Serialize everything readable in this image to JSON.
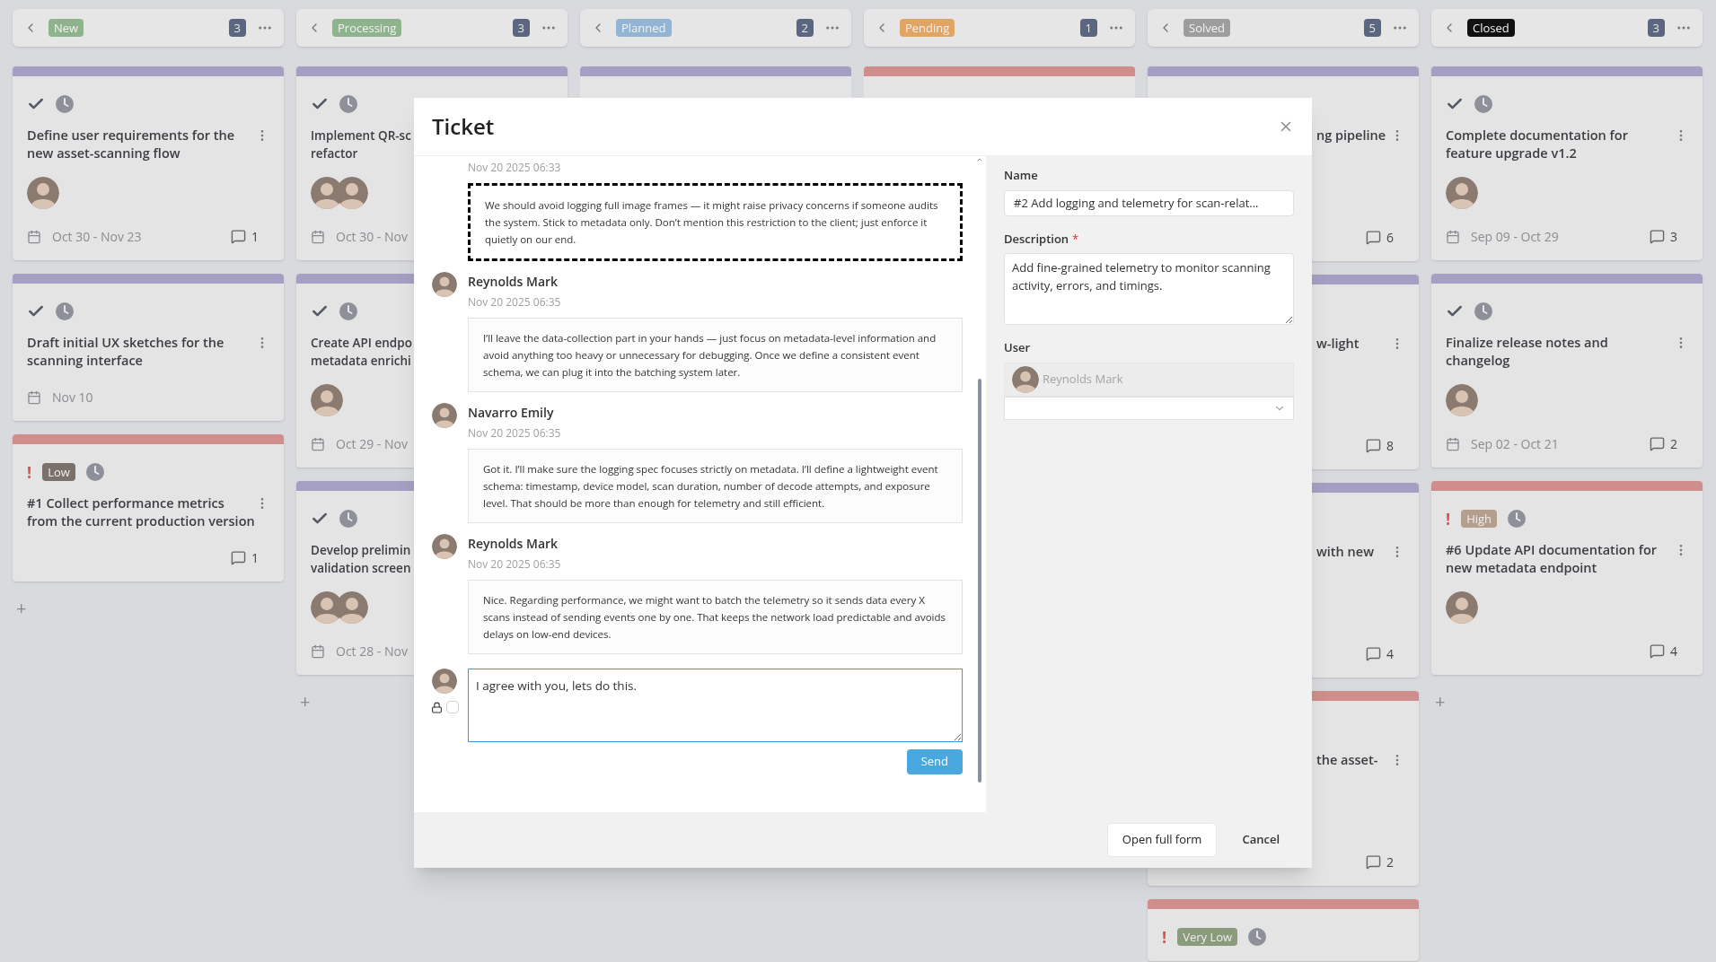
{
  "columns": [
    {
      "title": "New",
      "color": "#8fb38c",
      "count": "3",
      "cards": [
        {
          "kind": "task",
          "color": "#a5a0c3",
          "title": "Define user requirements for the new asset-scanning flow",
          "assignees": [
            {
              "kind": "photo"
            }
          ],
          "dates": "Oct 30 - Nov 23",
          "comments": "1"
        },
        {
          "kind": "task",
          "color": "#a5a0c3",
          "title": "Draft initial UX sketches for the scanning interface",
          "dates": "Nov 10"
        },
        {
          "kind": "issue",
          "color": "#cf8e8b",
          "marker": "!",
          "priority": {
            "label": "Low",
            "color": "#7b716b"
          },
          "title": "#1 Collect performance metrics from the current production version",
          "comments": "1"
        }
      ],
      "add": "+"
    },
    {
      "title": "Processing",
      "color": "#8fb38c",
      "count": "3",
      "cards": [
        {
          "kind": "task",
          "color": "#a5a0c3",
          "title": "Implement QR-sc\nrefactor",
          "assignees": [
            {
              "kind": "photo"
            },
            {
              "kind": "photo"
            }
          ],
          "dates": "Oct 30 - Nov"
        },
        {
          "kind": "task",
          "color": "#a5a0c3",
          "title": "Create API endpo\nmetadata enrichi",
          "assignees": [
            {
              "kind": "photo"
            }
          ],
          "dates": "Oct 29 - Nov"
        },
        {
          "kind": "task",
          "color": "#a5a0c3",
          "title": "Develop prelimin\nvalidation screen",
          "assignees": [
            {
              "kind": "photo"
            },
            {
              "kind": "photo"
            }
          ],
          "dates": "Oct 28 - Nov"
        }
      ],
      "add": "+"
    },
    {
      "title": "Planned",
      "color": "#94b4d3",
      "count": "2",
      "cards": [
        {
          "kind": "hidden",
          "color": "#a5a0c3"
        }
      ]
    },
    {
      "title": "Pending",
      "color": "#e0a565",
      "count": "1",
      "cards": [
        {
          "kind": "hidden",
          "color": "#cf8e8b"
        }
      ]
    },
    {
      "title": "Solved",
      "color": "#9d9d9d",
      "count": "5",
      "cards": [
        {
          "kind": "covered",
          "color": "#a5a0c3",
          "title": "ng pipeline",
          "comments": "6"
        },
        {
          "kind": "covered",
          "color": "#a5a0c3",
          "title": "w-light",
          "comments": "8"
        },
        {
          "kind": "covered",
          "color": "#a5a0c3",
          "title": "with new",
          "comments": "4"
        },
        {
          "kind": "covered",
          "color": "#cf8e8b",
          "title": "the asset-",
          "comments": "2"
        },
        {
          "kind": "issue",
          "color": "#cf8e8b",
          "marker": "!",
          "priority": {
            "label": "Very Low",
            "color": "#8a9c7c"
          }
        }
      ]
    },
    {
      "title": "Closed",
      "color": "#111111",
      "count": "3",
      "cards": [
        {
          "kind": "task",
          "color": "#a5a0c3",
          "title": "Complete documentation for feature upgrade v1.2",
          "assignees": [
            {
              "kind": "photo"
            }
          ],
          "dates": "Sep 09 - Oct 29",
          "comments": "3"
        },
        {
          "kind": "task",
          "color": "#a5a0c3",
          "title": "Finalize release notes and changelog",
          "assignees": [
            {
              "kind": "photo"
            }
          ],
          "dates": "Sep 02 - Oct 21",
          "comments": "2"
        },
        {
          "kind": "issue",
          "color": "#cf8e8b",
          "marker": "!",
          "priority": {
            "label": "High",
            "color": "#b49f8c"
          },
          "title": "#6 Update API documentation for new metadata endpoint",
          "assignees": [
            {
              "kind": "photo"
            }
          ],
          "comments": "4"
        }
      ],
      "add": "+"
    }
  ],
  "modal": {
    "title": "Ticket",
    "messages": [
      {
        "kind": "note",
        "time": "Nov 20 2025 06:33",
        "text": "We should avoid logging full image frames — it might raise privacy concerns if someone audits the system. Stick to metadata only. Don’t mention this restriction to the client; just enforce it quietly on our end."
      },
      {
        "kind": "comment",
        "author": "Reynolds Mark",
        "time": "Nov 20 2025 06:35",
        "text": "I’ll leave the data-collection part in your hands — just focus on metadata-level information and avoid anything too heavy or unnecessary for debugging. Once we define a consistent event schema, we can plug it into the batching system later."
      },
      {
        "kind": "comment",
        "author": "Navarro Emily",
        "time": "Nov 20 2025 06:35",
        "text": "Got it. I’ll make sure the logging spec focuses strictly on metadata. I’ll define a lightweight event schema: timestamp, device model, scan duration, number of decode attempts, and exposure level. That should be more than enough for telemetry and still efficient."
      },
      {
        "kind": "comment",
        "author": "Reynolds Mark",
        "time": "Nov 20 2025 06:35",
        "text": "Nice. Regarding performance, we might want to batch the telemetry so it sends data every X scans instead of sending events one by one. That keeps the network load predictable and avoids delays on low-end devices."
      }
    ],
    "composer": {
      "value": "I agree with you, lets do this.",
      "internal": false,
      "send": "Send"
    },
    "fields": {
      "name_label": "Name",
      "name_value": "#2 Add logging and telemetry for scan-relat...",
      "description_label": "Description",
      "required_mark": "*",
      "description_value": "Add fine-grained telemetry to monitor scanning activity, errors, and timings.",
      "user_label": "User",
      "user": {
        "name": "Reynolds Mark",
        "disabled": true
      }
    },
    "buttons": [
      "Open full form",
      "Cancel"
    ]
  }
}
